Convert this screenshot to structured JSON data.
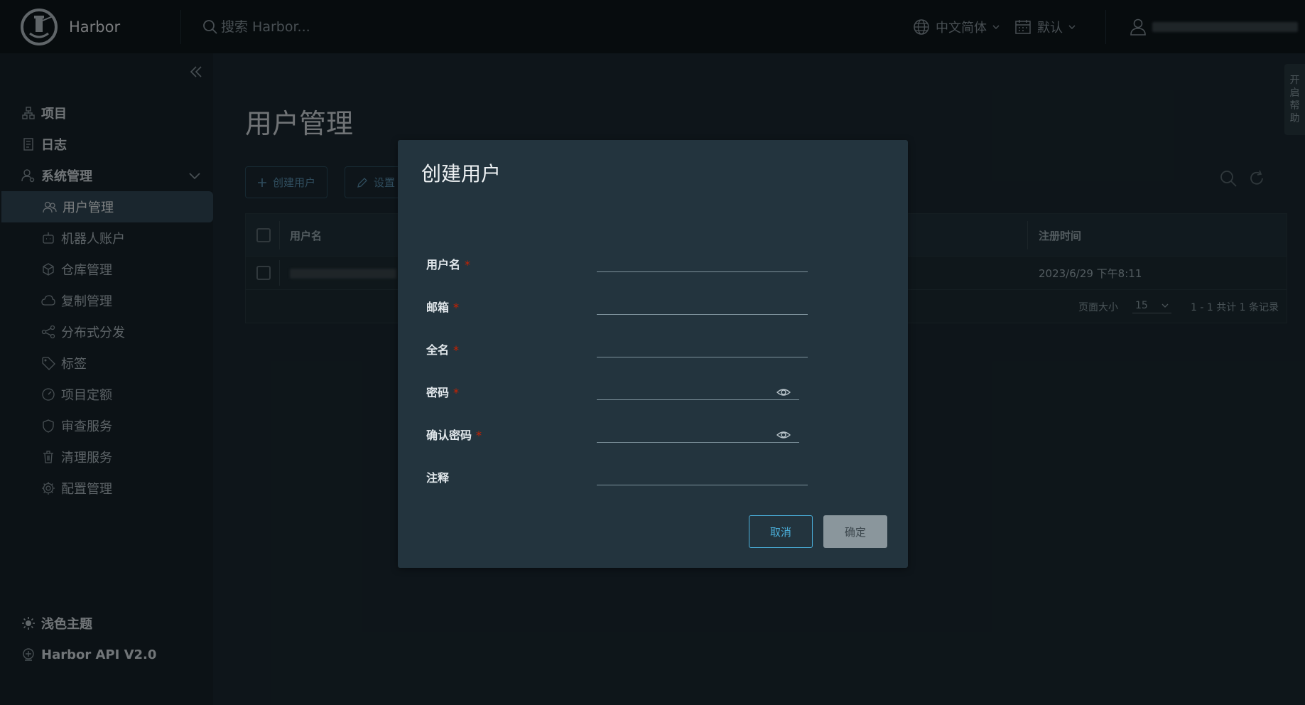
{
  "app": {
    "name": "Harbor"
  },
  "header": {
    "search_placeholder": "搜索 Harbor...",
    "language": "中文简体",
    "theme_mode": "默认"
  },
  "sidebar": {
    "items": [
      {
        "label": "项目"
      },
      {
        "label": "日志"
      },
      {
        "label": "系统管理"
      }
    ],
    "sub_items": [
      {
        "label": "用户管理"
      },
      {
        "label": "机器人账户"
      },
      {
        "label": "仓库管理"
      },
      {
        "label": "复制管理"
      },
      {
        "label": "分布式分发"
      },
      {
        "label": "标签"
      },
      {
        "label": "项目定额"
      },
      {
        "label": "审查服务"
      },
      {
        "label": "清理服务"
      },
      {
        "label": "配置管理"
      }
    ],
    "theme_toggle": "浅色主题",
    "api_link": "Harbor API V2.0"
  },
  "main": {
    "title": "用户管理",
    "create_button": "创建用户",
    "settings_button": "设置",
    "columns": [
      "用户名",
      "注册时间"
    ],
    "rows": [
      {
        "registered": "2023/6/29 下午8:11"
      }
    ],
    "pagination": {
      "page_size_label": "页面大小",
      "page_size": "15",
      "summary": "1 - 1 共计 1 条记录"
    }
  },
  "side_tab": {
    "chars": [
      "开",
      "启",
      "帮",
      "助"
    ]
  },
  "modal": {
    "title": "创建用户",
    "fields": [
      {
        "label": "用户名",
        "required": "*",
        "value": ""
      },
      {
        "label": "邮箱",
        "required": "*",
        "value": ""
      },
      {
        "label": "全名",
        "required": "*",
        "value": ""
      },
      {
        "label": "密码",
        "required": "*",
        "value": ""
      },
      {
        "label": "确认密码",
        "required": "*",
        "value": ""
      },
      {
        "label": "注释",
        "value": ""
      }
    ],
    "cancel": "取消",
    "confirm": "确定"
  },
  "colors": {
    "header_bg": "#0f171c",
    "sidebar_bg": "#17242b",
    "modal_bg": "#23343e",
    "accent": "#4aaed9",
    "required": "#c92100"
  }
}
